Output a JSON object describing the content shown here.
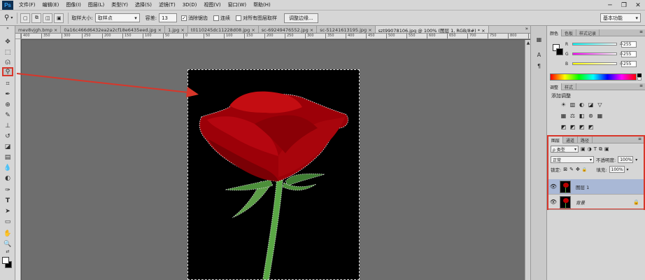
{
  "menubar": {
    "logo": "Ps",
    "items": [
      "文件(F)",
      "编辑(E)",
      "图像(I)",
      "图层(L)",
      "类型(Y)",
      "选择(S)",
      "滤镜(T)",
      "3D(D)",
      "视图(V)",
      "窗口(W)",
      "帮助(H)"
    ],
    "win_minimize": "─",
    "win_restore": "❐",
    "win_close": "✕"
  },
  "options": {
    "sample_size_label": "取样大小:",
    "sample_size_value": "取样点",
    "tolerance_label": "容差:",
    "tolerance_value": "13",
    "antialias_label": "消除锯齿",
    "antialias_checked": "✓",
    "contiguous_label": "连续",
    "sample_all_label": "对所有图层取样",
    "refine_edge_button": "调整边缘...",
    "workspace": "基本功能"
  },
  "tabs": [
    {
      "label": "mev8vjgh.bmp ×",
      "active": false
    },
    {
      "label": "0a16c466d6432ea2a2cf18e6435eed.jpg ×",
      "active": false
    },
    {
      "label": "1.jpg ×",
      "active": false
    },
    {
      "label": "t0110245dc11228d08.jpg ×",
      "active": false
    },
    {
      "label": "sc-69249476552.jpg ×",
      "active": false
    },
    {
      "label": "sc-51241613195.jpg ×",
      "active": false
    },
    {
      "label": "szt99078106.jpg @ 100% (图层 1, RGB/8#) * ×",
      "active": true
    }
  ],
  "tabs_more": "»",
  "ruler_ticks": [
    "400",
    "350",
    "300",
    "250",
    "200",
    "150",
    "100",
    "50",
    "0",
    "50",
    "100",
    "150",
    "200",
    "250",
    "300",
    "350",
    "400",
    "450",
    "500",
    "550",
    "600",
    "650",
    "700",
    "750",
    "800",
    "850"
  ],
  "color_panel": {
    "tabs": [
      "颜色",
      "色板",
      "样式记录"
    ],
    "channels": [
      {
        "label": "R",
        "value": "255",
        "gradient": "linear-gradient(to right, #00ffff, #ffffff)"
      },
      {
        "label": "G",
        "value": "255",
        "gradient": "linear-gradient(to right, #ff00ff, #ffffff)"
      },
      {
        "label": "B",
        "value": "255",
        "gradient": "linear-gradient(to right, #ffff00, #ffffff)"
      }
    ]
  },
  "adjustments_panel": {
    "tabs": [
      "调整",
      "样式"
    ],
    "title": "添加调整",
    "icons_row1": [
      "☀",
      "▥",
      "◐",
      "◪",
      "▽"
    ],
    "icons_row2": [
      "▦",
      "⚖",
      "◧",
      "⊛",
      "▦"
    ],
    "icons_row3": [
      "◩",
      "◩",
      "◩",
      "◩"
    ]
  },
  "layers_panel": {
    "tabs": [
      "图层",
      "通道",
      "路径"
    ],
    "filter_label": "ρ 类型",
    "filter_icons": [
      "▣",
      "◑",
      "T",
      "⧉",
      "▣"
    ],
    "blend_mode": "正常",
    "opacity_label": "不透明度:",
    "opacity_value": "100%",
    "lock_label": "锁定:",
    "lock_icons": [
      "⊠",
      "✎",
      "✥",
      "🔒"
    ],
    "fill_label": "填充:",
    "fill_value": "100%",
    "layers": [
      {
        "name": "图层 1",
        "visible": "👁",
        "selected": true,
        "lock": ""
      },
      {
        "name": "背景",
        "visible": "👁",
        "selected": false,
        "lock": "🔒"
      }
    ]
  },
  "colors": {
    "highlight_red": "#d8362a",
    "rose_red": "#a80000",
    "selected_layer": "#a9b8d6"
  }
}
